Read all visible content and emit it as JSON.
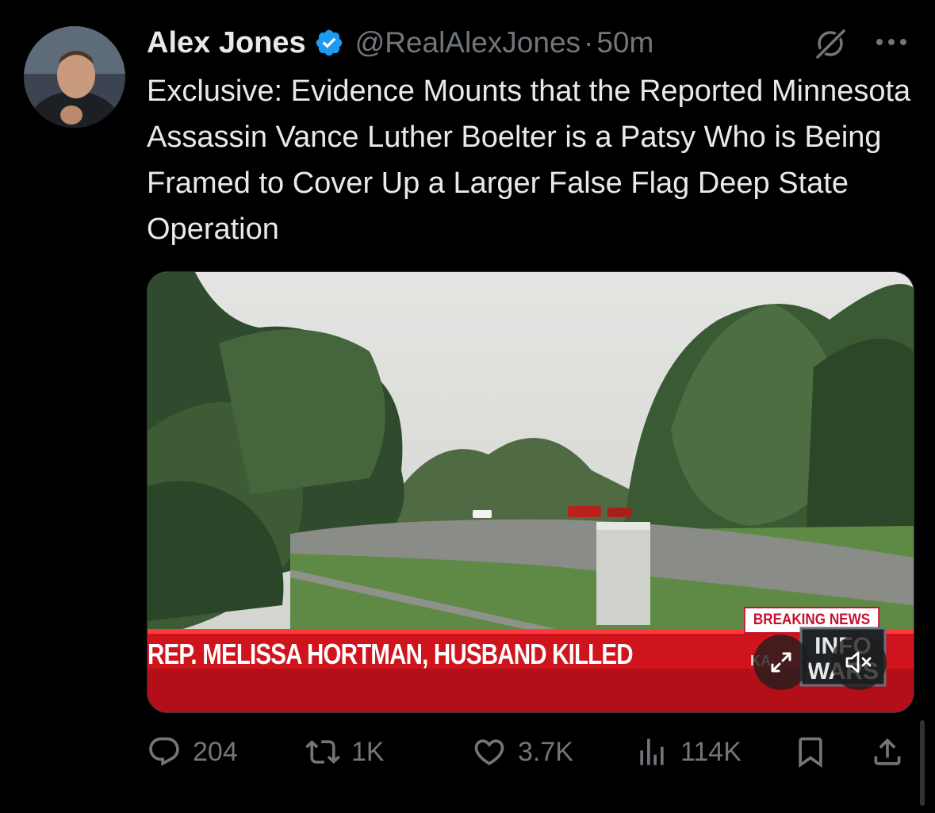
{
  "tweet": {
    "author_name": "Alex Jones",
    "handle": "@RealAlexJones",
    "separator": "·",
    "time": "50m",
    "text": "Exclusive: Evidence Mounts that the Reported Minnesota Assassin Vance Luther Boelter is a Patsy Who is Being Framed to Cover Up a Larger False Flag Deep State Operation",
    "verified_color": "#1d9bf0"
  },
  "media": {
    "breaking_label": "BREAKING NEWS",
    "headline": "REP. MELISSA HORTMAN, HUSBAND KILLED",
    "logo_top": "INFO",
    "logo_bottom": "WARS",
    "ticker_partial": "KA",
    "banner_color": "#d0141e",
    "controls": {
      "expand_icon": "expand-icon",
      "mute_icon": "speaker-muted-icon"
    }
  },
  "actions": {
    "replies": "204",
    "reposts": "1K",
    "likes": "3.7K",
    "views": "114K"
  },
  "icons": {
    "grok": "grok-icon",
    "more": "more-dots-icon",
    "reply": "reply-icon",
    "repost": "repost-icon",
    "like": "heart-icon",
    "views": "views-bar-chart-icon",
    "bookmark": "bookmark-icon",
    "share": "share-icon"
  }
}
